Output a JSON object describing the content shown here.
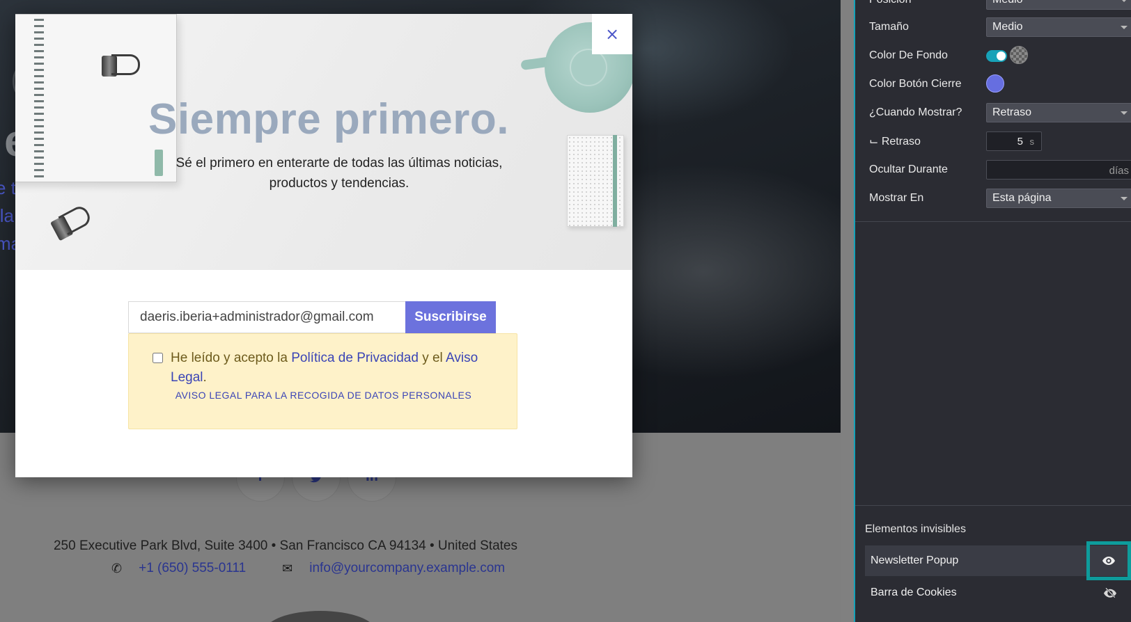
{
  "site": {
    "hero_left_lines": [
      "e t",
      "lla",
      "ma"
    ],
    "hero_big_letter": "e",
    "social": [
      {
        "icon": "facebook-icon",
        "glyph": "f"
      },
      {
        "icon": "twitter-icon",
        "glyph": "𝕥"
      },
      {
        "icon": "linkedin-icon",
        "glyph": "in"
      }
    ],
    "address": "250 Executive Park Blvd, Suite 3400 • San Francisco CA 94134 • United States",
    "phone": "+1 (650) 555-0111",
    "email": "info@yourcompany.example.com"
  },
  "popup": {
    "close_glyph": "×",
    "title": "Siempre primero.",
    "subtitle_line1": "Sé el primero en enterarte de todas las últimas noticias,",
    "subtitle_line2": "productos y tendencias.",
    "email_value": "daeris.iberia+administrador@gmail.com",
    "subscribe_label": "Suscribirse",
    "legal_prefix": "He leído y acepto la ",
    "legal_link1": "Política de Privacidad",
    "legal_mid": " y el ",
    "legal_link2": "Aviso Legal",
    "legal_suffix": ".",
    "legal_caps": "AVISO LEGAL PARA LA RECOGIDA DE DATOS PERSONALES"
  },
  "panel": {
    "colors": {
      "accent": "#17a2b8",
      "close_button_color": "#666ee0",
      "highlight": "#0e9c9c"
    },
    "options": {
      "posicion_label": "Posición",
      "posicion_value": "Medio",
      "tamano_label": "Tamaño",
      "tamano_value": "Medio",
      "color_fondo_label": "Color De Fondo",
      "color_cierre_label": "Color Botón Cierre",
      "cuando_label": "¿Cuando Mostrar?",
      "cuando_value": "Retraso",
      "retraso_label": "⌙ Retraso",
      "retraso_value": "5",
      "retraso_unit": "s",
      "ocultar_label": "Ocultar Durante",
      "ocultar_unit": "días",
      "mostrar_label": "Mostrar En",
      "mostrar_value": "Esta página"
    },
    "invisible_title": "Elementos invisibles",
    "invisible_items": [
      {
        "label": "Newsletter Popup",
        "icon": "eye-icon"
      },
      {
        "label": "Barra de Cookies",
        "icon": "eye-slash-icon"
      }
    ]
  }
}
